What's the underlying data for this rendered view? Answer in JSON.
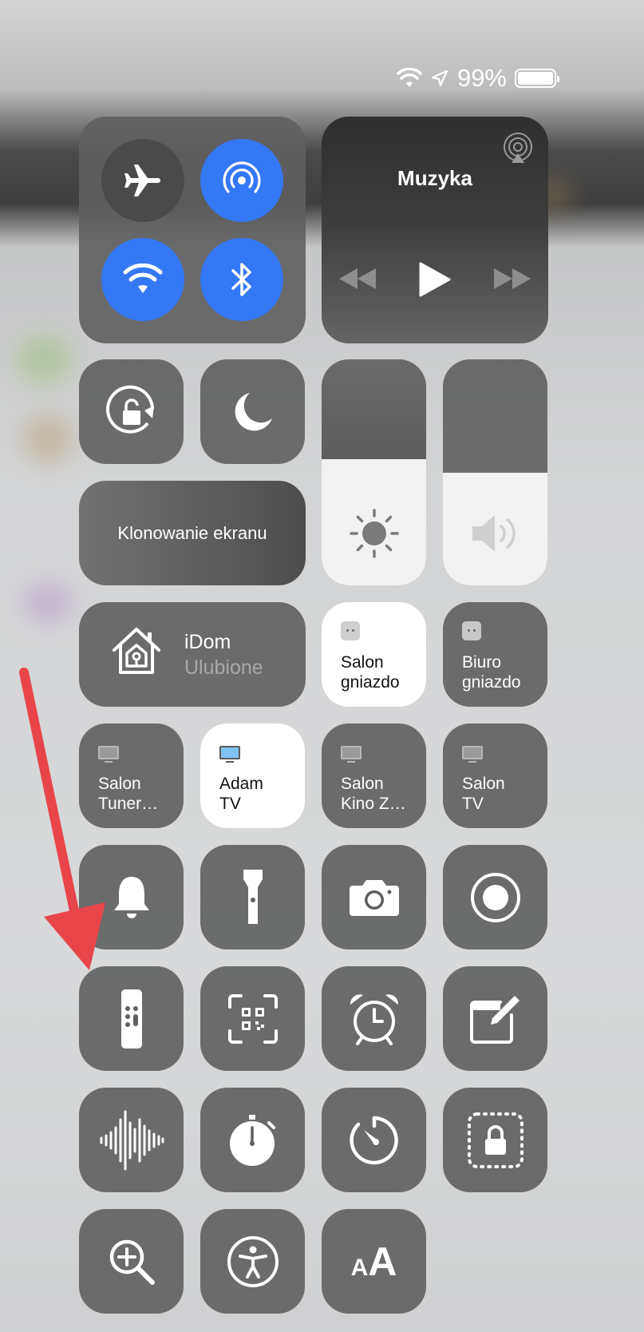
{
  "status_bar": {
    "battery_text": "99%",
    "battery_level": 0.99,
    "icons": [
      "wifi-icon",
      "location-arrow-icon",
      "battery-icon"
    ]
  },
  "connectivity": {
    "airplane": {
      "icon": "airplane-icon",
      "active": false
    },
    "airdrop": {
      "icon": "airdrop-icon",
      "active": true
    },
    "wifi": {
      "icon": "wifi-icon",
      "active": true
    },
    "bluetooth": {
      "icon": "bluetooth-icon",
      "active": true
    },
    "active_color": "#3478f6"
  },
  "music": {
    "title": "Muzyka",
    "icons": [
      "airplay-icon",
      "rewind-icon",
      "play-icon",
      "fast-forward-icon"
    ]
  },
  "orientation_lock": {
    "icon": "rotation-lock-icon"
  },
  "do_not_disturb": {
    "icon": "moon-icon"
  },
  "screen_mirroring": {
    "label": "Klonowanie ekranu"
  },
  "brightness": {
    "icon": "sun-icon",
    "level": 0.56
  },
  "volume": {
    "icon": "speaker-icon",
    "level": 0.5
  },
  "home": {
    "title": "iDom",
    "subtitle": "Ulubione",
    "icon": "home-icon"
  },
  "accessories": [
    {
      "line1": "Salon",
      "line2": "gniazdo",
      "icon": "outlet-icon",
      "active": true
    },
    {
      "line1": "Biuro",
      "line2": "gniazdo",
      "icon": "outlet-icon",
      "active": false
    }
  ],
  "tvs": [
    {
      "line1": "Salon",
      "line2": "Tuner…",
      "icon": "tv-icon",
      "active": false
    },
    {
      "line1": "Adam",
      "line2": "TV",
      "icon": "tv-icon",
      "active": true
    },
    {
      "line1": "Salon",
      "line2": "Kino Z…",
      "icon": "tv-icon",
      "active": false
    },
    {
      "line1": "Salon",
      "line2": "TV",
      "icon": "tv-icon",
      "active": false
    }
  ],
  "controls": [
    "bell-icon",
    "flashlight-icon",
    "camera-icon",
    "screen-record-icon",
    "apple-tv-remote-icon",
    "qr-code-scanner-icon",
    "alarm-clock-icon",
    "notes-icon",
    "voice-memos-icon",
    "stopwatch-icon",
    "timer-icon",
    "guided-access-icon",
    "magnifier-icon",
    "accessibility-icon",
    "text-size-icon"
  ],
  "text_size_label": "AA",
  "annotation": {
    "icon": "red-arrow",
    "color": "#e8454a"
  }
}
